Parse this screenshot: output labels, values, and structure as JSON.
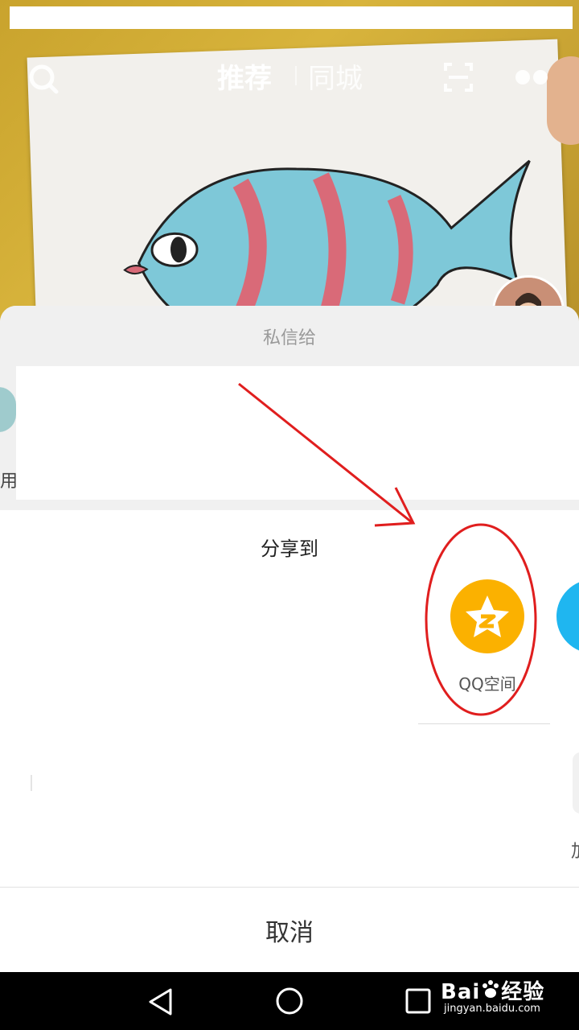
{
  "top_nav": {
    "tab_recommend": "推荐",
    "tab_local": "同城",
    "search_icon": "search-icon",
    "scan_icon": "scan-icon",
    "more_icon": "more-icon"
  },
  "share_sheet": {
    "dm_title": "私信给",
    "dm_partial_name": "用",
    "share_title": "分享到",
    "apps": [
      {
        "label": "QQ空间",
        "icon": "qzone-star-icon",
        "color": "#fbb100"
      }
    ],
    "next_app_color": "#1fb6f0",
    "partial_action_label": "加",
    "cancel_label": "取消"
  },
  "annotation": {
    "color": "#e01e1e"
  },
  "watermark": {
    "brand": "Bai",
    "brand_suffix": "经验",
    "url": "jingyan.baidu.com"
  }
}
